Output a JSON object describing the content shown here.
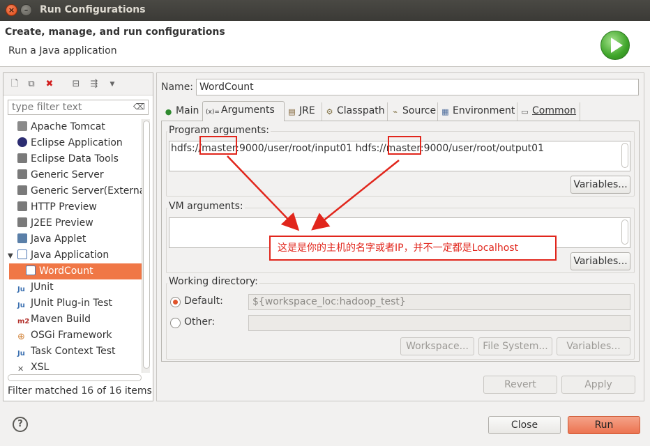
{
  "window": {
    "title": "Run Configurations"
  },
  "header": {
    "title": "Create, manage, and run configurations",
    "subtitle": "Run a Java application",
    "run_icon": "run-play-icon"
  },
  "left": {
    "toolbar_icons": [
      "new-config-icon",
      "duplicate-icon",
      "delete-icon",
      "collapse-all-icon",
      "filter-icon",
      "view-menu-icon"
    ],
    "filter_placeholder": "type filter text",
    "items": [
      {
        "label": "Apache Tomcat",
        "icon": "tomcat-icon",
        "color": "#8a8a8a"
      },
      {
        "label": "Eclipse Application",
        "icon": "eclipse-icon",
        "color": "#2c2d72"
      },
      {
        "label": "Eclipse Data Tools",
        "icon": "data-tools-icon",
        "color": "#7a7a7a"
      },
      {
        "label": "Generic Server",
        "icon": "server-icon",
        "color": "#7a7a7a"
      },
      {
        "label": "Generic Server(External",
        "icon": "server-icon",
        "color": "#7a7a7a"
      },
      {
        "label": "HTTP Preview",
        "icon": "server-icon",
        "color": "#7a7a7a"
      },
      {
        "label": "J2EE Preview",
        "icon": "server-icon",
        "color": "#7a7a7a"
      },
      {
        "label": "Java Applet",
        "icon": "applet-icon",
        "color": "#5a7fa8"
      },
      {
        "label": "Java Application",
        "icon": "java-app-icon",
        "color": "#4d77b3",
        "expanded": true
      },
      {
        "label": "WordCount",
        "icon": "java-app-icon",
        "color": "#4d77b3",
        "selected": true
      },
      {
        "label": "JUnit",
        "icon": "junit-icon",
        "color": "#3a6fb0"
      },
      {
        "label": "JUnit Plug-in Test",
        "icon": "junit-plugin-icon",
        "color": "#3a6fb0"
      },
      {
        "label": "Maven Build",
        "icon": "maven-icon",
        "color": "#b2302b"
      },
      {
        "label": "OSGi Framework",
        "icon": "osgi-icon",
        "color": "#d2843a"
      },
      {
        "label": "Task Context Test",
        "icon": "task-test-icon",
        "color": "#3a6fb0"
      },
      {
        "label": "XSL",
        "icon": "xsl-icon",
        "color": "#555555"
      }
    ],
    "status": "Filter matched 16 of 16 items"
  },
  "right": {
    "name_label": "Name:",
    "name_value": "WordCount",
    "tabs": [
      {
        "label": "Main",
        "icon": "main-tab-icon",
        "glyph": "●"
      },
      {
        "label": "Arguments",
        "icon": "arguments-tab-icon",
        "glyph": "(x)=",
        "active": true
      },
      {
        "label": "JRE",
        "icon": "jre-tab-icon",
        "glyph": "▤"
      },
      {
        "label": "Classpath",
        "icon": "classpath-tab-icon",
        "glyph": "⚙"
      },
      {
        "label": "Source",
        "icon": "source-tab-icon",
        "glyph": "⌁"
      },
      {
        "label": "Environment",
        "icon": "environment-tab-icon",
        "glyph": "▦"
      },
      {
        "label": "Common",
        "icon": "common-tab-icon",
        "glyph": "▭"
      }
    ],
    "program_args": {
      "label": "Program arguments:",
      "value": "hdfs://master:9000/user/root/input01  hdfs://master:9000/user/root/output01",
      "variables": "Variables..."
    },
    "vm_args": {
      "label": "VM arguments:",
      "value": "",
      "variables": "Variables..."
    },
    "working_dir": {
      "label": "Working directory:",
      "default_label": "Default:",
      "default_value": "${workspace_loc:hadoop_test}",
      "other_label": "Other:",
      "other_value": "",
      "workspace_btn": "Workspace...",
      "filesystem_btn": "File System...",
      "variables_btn": "Variables..."
    },
    "revert": "Revert",
    "apply": "Apply"
  },
  "annotation": {
    "text": "这是是你的主机的名字或者IP，并不一定都是Localhost",
    "color": "#e1261c"
  },
  "footer": {
    "help": "?",
    "close": "Close",
    "run": "Run"
  }
}
